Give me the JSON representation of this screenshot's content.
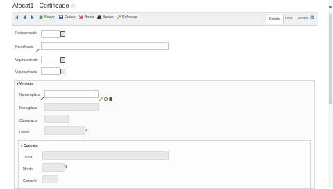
{
  "window": {
    "title": "Afocat1 - Certificado"
  },
  "toolbar": {
    "nuevo": "Nuevo",
    "grabar": "Grabar",
    "borrar": "Borrar",
    "buscar": "Buscar",
    "refrescar": "Refrescar"
  },
  "tabs": [
    {
      "label": "Detalle",
      "active": true
    },
    {
      "label": "Lista",
      "active": false
    },
    {
      "label": "Ventas",
      "active": false
    }
  ],
  "form": {
    "fecha_label": "Fechaemisión",
    "certificado_label": "Ncertificado",
    "vigencia_desde_label": "Vigenciadesde",
    "vigencia_hasta_label": "Vigenciahasta"
  },
  "vehiculo_section": {
    "title": "Vehículo",
    "placa_label": "Numeroplaca",
    "marca_label": "Marcaplaca",
    "clase_label": "Claseplaca",
    "uso_label": "Usado",
    "uso_unit": "$"
  },
  "contrato_section": {
    "title": "Contrato",
    "titular_label": "Titular",
    "monto_label": "Monto",
    "monto_unit": "$",
    "comision_label": "Comisión"
  }
}
